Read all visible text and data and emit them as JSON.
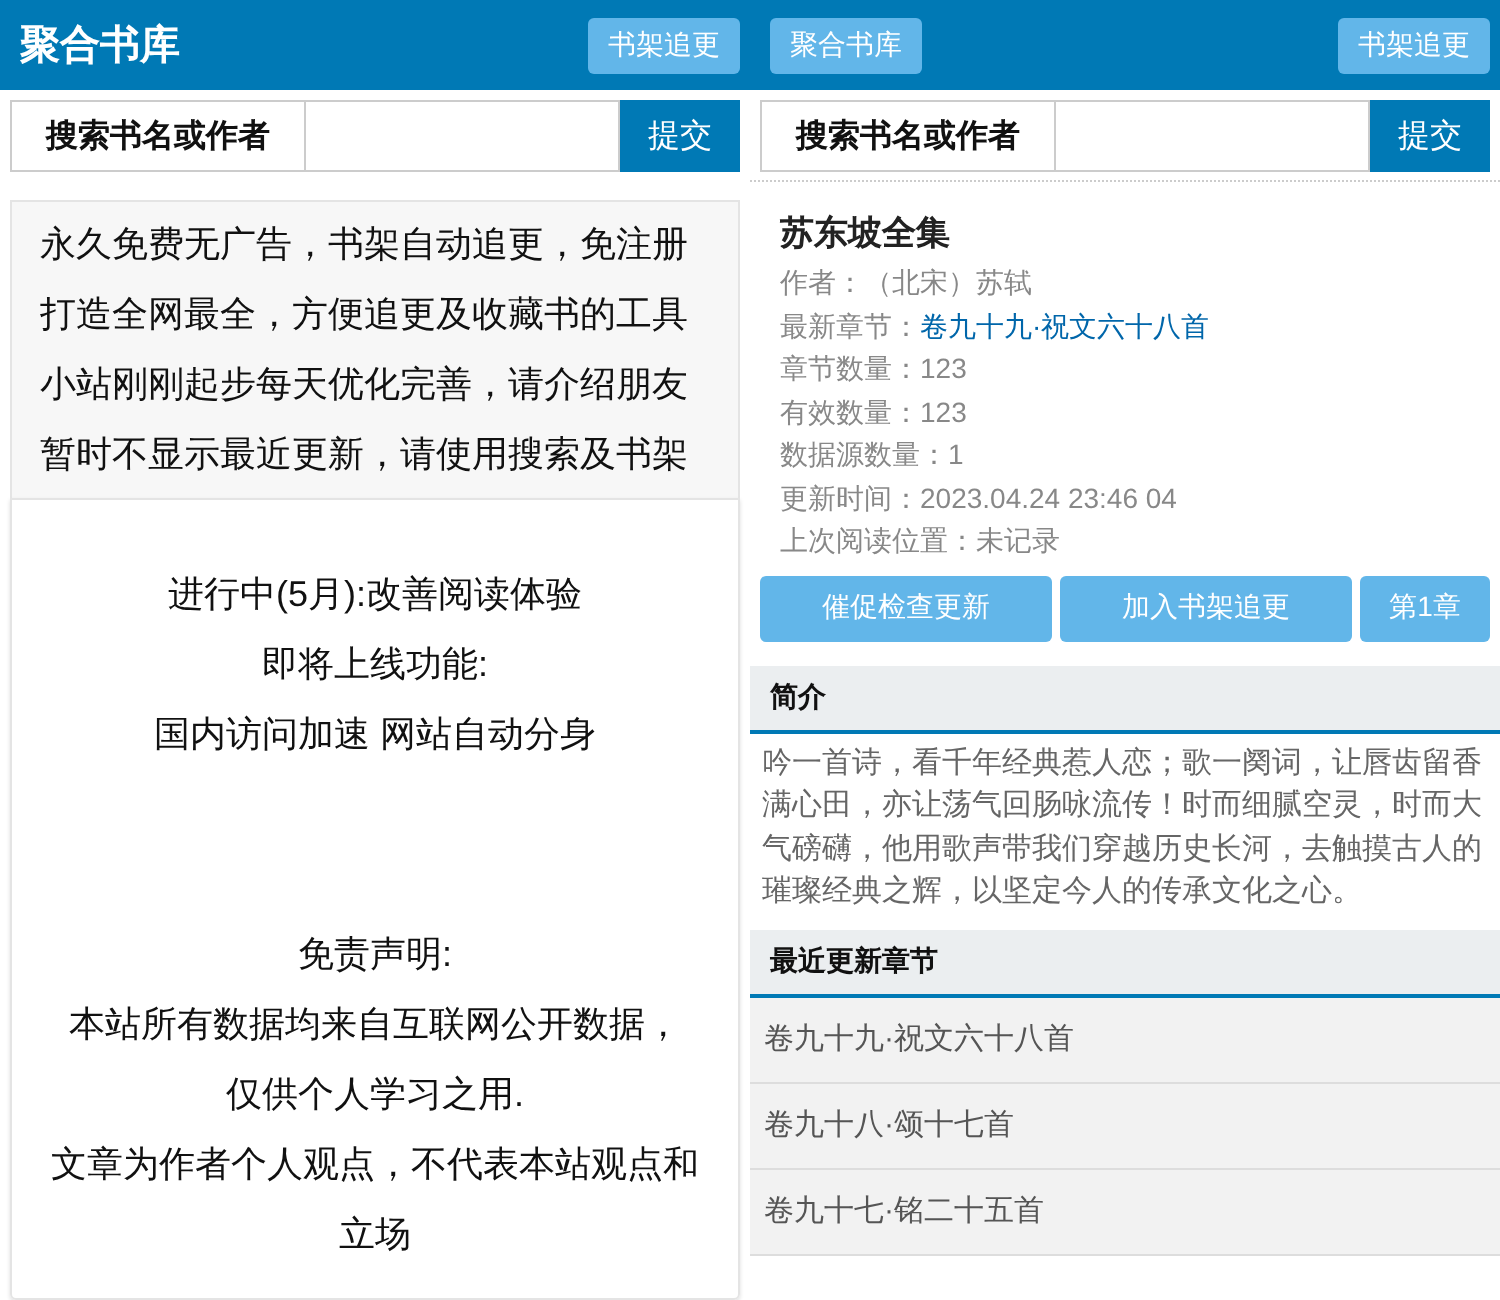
{
  "left_screen": {
    "header": {
      "title": "聚合书库",
      "button": "书架追更"
    },
    "search": {
      "label": "搜索书名或作者",
      "submit": "提交"
    },
    "notice": {
      "lines": [
        "永久免费无广告，书架自动追更，免注册",
        "打造全网最全，方便追更及收藏书的工具",
        "小站刚刚起步每天优化完善，请介绍朋友",
        "暂时不显示最近更新，请使用搜索及书架"
      ]
    },
    "announcement": {
      "status_lines": [
        "进行中(5月):改善阅读体验",
        "即将上线功能:",
        "国内访问加速 网站自动分身"
      ],
      "disclaimer_lines": [
        "免责声明:",
        "本站所有数据均来自互联网公开数据，",
        "仅供个人学习之用.",
        "文章为作者个人观点，不代表本站观点和立场"
      ]
    }
  },
  "right_screen": {
    "header": {
      "home_button": "聚合书库",
      "button": "书架追更"
    },
    "search": {
      "label": "搜索书名或作者",
      "submit": "提交"
    },
    "book": {
      "title": "苏东坡全集",
      "fields": [
        {
          "label": "作者：",
          "value": "（北宋）苏轼",
          "kind": "text"
        },
        {
          "label": "最新章节：",
          "value": "卷九十九·祝文六十八首",
          "kind": "link"
        },
        {
          "label": "章节数量：",
          "value": "123",
          "kind": "text"
        },
        {
          "label": "有效数量：",
          "value": "123",
          "kind": "text"
        },
        {
          "label": "数据源数量：",
          "value": "1",
          "kind": "text"
        },
        {
          "label": "更新时间：",
          "value": "2023.04.24 23:46 04",
          "kind": "text"
        },
        {
          "label": "上次阅读位置：",
          "value": "未记录",
          "kind": "text"
        }
      ],
      "actions": [
        "催促检查更新",
        "加入书架追更",
        "第1章"
      ]
    },
    "intro": {
      "heading": "简介",
      "text": "吟一首诗，看千年经典惹人恋；歌一阕词，让唇齿留香满心田，亦让荡气回肠咏流传！时而细腻空灵，时而大气磅礴，他用歌声带我们穿越历史长河，去触摸古人的璀璨经典之辉，以坚定今人的传承文化之心。"
    },
    "chapters": {
      "heading": "最近更新章节",
      "items": [
        "卷九十九·祝文六十八首",
        "卷九十八·颂十七首",
        "卷九十七·铭二十五首"
      ]
    }
  }
}
